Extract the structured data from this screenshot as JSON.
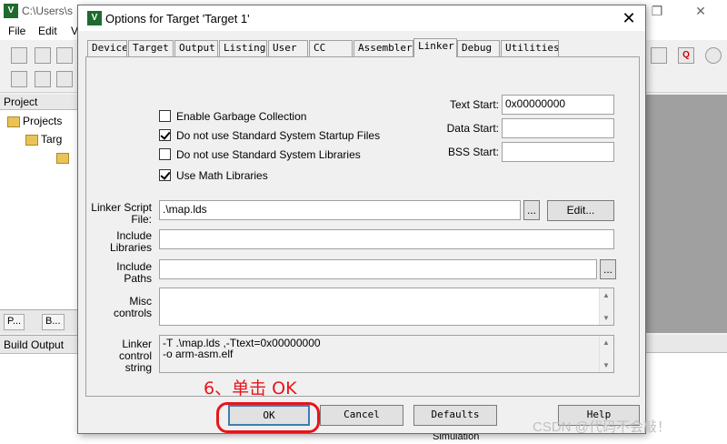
{
  "ide": {
    "title": "C:\\Users\\s",
    "menu": [
      "File",
      "Edit",
      "V"
    ],
    "project_panel_title": "Project",
    "tree": [
      "Projects",
      "Targ"
    ],
    "panel_tabs": [
      "P...",
      "B..."
    ],
    "build_output_title": "Build Output",
    "status_text": "Simulation"
  },
  "dialog": {
    "title": "Options for Target 'Target 1'",
    "close_glyph": "✕",
    "tabs": [
      "Device",
      "Target",
      "Output",
      "Listing",
      "User",
      "CC",
      "Assembler",
      "Linker",
      "Debug",
      "Utilities"
    ],
    "active_tab": "Linker",
    "checkboxes": [
      {
        "label": "Enable Garbage Collection",
        "checked": false
      },
      {
        "label": "Do not use Standard System Startup Files",
        "checked": true
      },
      {
        "label": "Do not use Standard System Libraries",
        "checked": false
      },
      {
        "label": "Use Math Libraries",
        "checked": true
      }
    ],
    "text_start_label": "Text Start:",
    "text_start_value": "0x00000000",
    "data_start_label": "Data Start:",
    "data_start_value": "",
    "bss_start_label": "BSS Start:",
    "bss_start_value": "",
    "linker_script_label_1": "Linker Script",
    "linker_script_label_2": "File:",
    "linker_script_value": ".\\map.lds",
    "browse_label": "...",
    "edit_label": "Edit...",
    "include_libraries_label_1": "Include",
    "include_libraries_label_2": "Libraries",
    "include_libraries_value": "",
    "include_paths_label_1": "Include",
    "include_paths_label_2": "Paths",
    "include_paths_value": "",
    "misc_label_1": "Misc",
    "misc_label_2": "controls",
    "misc_value": "",
    "linker_string_label_1": "Linker",
    "linker_string_label_2": "control",
    "linker_string_label_3": "string",
    "linker_string_lines": [
      "-T .\\map.lds ,-Ttext=0x00000000",
      "-o arm-asm.elf"
    ],
    "buttons": {
      "ok": "OK",
      "cancel": "Cancel",
      "defaults": "Defaults",
      "help": "Help"
    }
  },
  "annotation": "6、单击 OK",
  "watermark": "CSDN @代码不会敲！",
  "colors": {
    "annotation_red": "#e8141c",
    "default_button_border": "#3c7fb1"
  }
}
